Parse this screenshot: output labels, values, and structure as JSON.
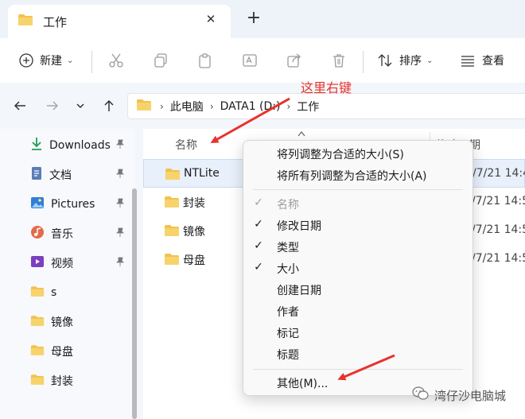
{
  "tab": {
    "title": "工作",
    "close": "✕",
    "new": "+"
  },
  "toolbar": {
    "new_label": "新建",
    "sort_label": "排序",
    "view_label": "查看",
    "chevron": "⌄"
  },
  "nav": {
    "crumb_sep": "›",
    "breadcrumbs": [
      "此电脑",
      "DATA1 (D:)",
      "工作"
    ]
  },
  "sidebar": {
    "items": [
      {
        "label": "Downloads",
        "icon": "download-icon",
        "pinned": true
      },
      {
        "label": "文档",
        "icon": "document-icon",
        "pinned": true
      },
      {
        "label": "Pictures",
        "icon": "pictures-icon",
        "pinned": true
      },
      {
        "label": "音乐",
        "icon": "music-icon",
        "pinned": true
      },
      {
        "label": "视频",
        "icon": "video-icon",
        "pinned": true
      },
      {
        "label": "s",
        "icon": "folder-icon",
        "pinned": false
      },
      {
        "label": "镜像",
        "icon": "folder-icon",
        "pinned": false
      },
      {
        "label": "母盘",
        "icon": "folder-icon",
        "pinned": false
      },
      {
        "label": "封装",
        "icon": "folder-icon",
        "pinned": false
      }
    ]
  },
  "content": {
    "col_name": "名称",
    "col_date": "修改日期",
    "files": [
      {
        "name": "NTLite",
        "date": "/7/21 14:48",
        "selected": true
      },
      {
        "name": "封装",
        "date": "/7/21 14:57",
        "selected": false
      },
      {
        "name": "镜像",
        "date": "/7/21 14:57",
        "selected": false
      },
      {
        "name": "母盘",
        "date": "/7/21 14:57",
        "selected": false
      }
    ]
  },
  "context_menu": {
    "fit_column": "将列调整为合适的大小(S)",
    "fit_all_columns": "将所有列调整为合适的大小(A)",
    "check": "✓",
    "columns": [
      {
        "label": "名称",
        "checked": true,
        "disabled": true
      },
      {
        "label": "修改日期",
        "checked": true,
        "disabled": false
      },
      {
        "label": "类型",
        "checked": true,
        "disabled": false
      },
      {
        "label": "大小",
        "checked": true,
        "disabled": false
      },
      {
        "label": "创建日期",
        "checked": false,
        "disabled": false
      },
      {
        "label": "作者",
        "checked": false,
        "disabled": false
      },
      {
        "label": "标记",
        "checked": false,
        "disabled": false
      },
      {
        "label": "标题",
        "checked": false,
        "disabled": false
      }
    ],
    "more": "其他(M)..."
  },
  "annotation": {
    "text": "这里右键",
    "color": "#e8322a"
  },
  "watermark": {
    "text": "湾仔沙电脑城"
  },
  "colors": {
    "folder": "#f2c14e",
    "accent": "#0067c0",
    "selected_bg": "#e8f0fb"
  }
}
